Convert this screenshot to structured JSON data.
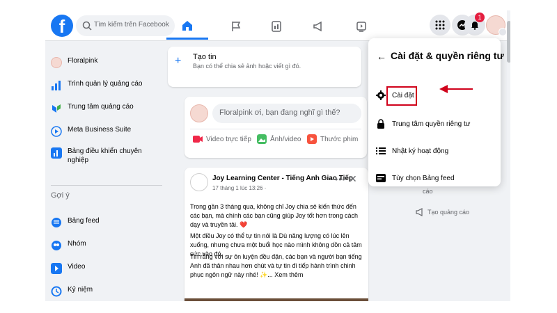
{
  "search": {
    "placeholder": "Tìm kiếm trên Facebook"
  },
  "notifications": {
    "count": "1"
  },
  "sidebar": {
    "items": [
      {
        "label": "Floralpink"
      },
      {
        "label": "Trình quản lý quảng cáo"
      },
      {
        "label": "Trung tâm quảng cáo"
      },
      {
        "label": "Meta Business Suite"
      },
      {
        "label": "Bảng điều khiển chuyên nghiệp"
      }
    ],
    "section_title": "Gợi ý",
    "suggestions": [
      {
        "label": "Bảng feed"
      },
      {
        "label": "Nhóm"
      },
      {
        "label": "Video"
      },
      {
        "label": "Kỷ niệm"
      }
    ]
  },
  "story": {
    "title": "Tạo tin",
    "subtitle": "Bạn có thể chia sẻ ảnh hoặc viết gì đó."
  },
  "composer": {
    "placeholder": "Floralpink ơi, bạn đang nghĩ gì thế?",
    "actions": [
      {
        "label": "Video trực tiếp"
      },
      {
        "label": "Ảnh/video"
      },
      {
        "label": "Thước phim"
      }
    ]
  },
  "post": {
    "author": "Joy Learning Center - Tiếng Anh Giao Tiếp",
    "time": "17 tháng 1 lúc 13:26 ·",
    "p1": "Trong gần 3 tháng qua, không chỉ Joy chia sẻ kiến thức đến các bạn, mà chính các bạn cũng giúp Joy tốt hơn trong cách dạy và truyền tải. ❤️",
    "p2": "Một điều Joy có thể tự tin nói là Dù năng lượng có lúc lên xuống, nhưng chưa một buổi học nào mình không dồn cả tâm sức vào đó.",
    "p3": "Tin rằng với sự ôn luyện đều đặn, các bạn và người bạn tiếng Anh đã thân nhau hơn chút và tự tin đi tiếp hành trình chinh phục ngôn ngữ này nhé! ✨... Xem thêm"
  },
  "right_column": {
    "text1": "cáo",
    "text2": "Tạo quảng cáo"
  },
  "dropdown": {
    "title": "Cài đặt & quyền riêng tư",
    "items": [
      {
        "label": "Cài đặt"
      },
      {
        "label": "Trung tâm quyền riêng tư"
      },
      {
        "label": "Nhật ký hoạt động"
      },
      {
        "label": "Tùy chọn Bảng feed"
      }
    ]
  },
  "colors": {
    "brand": "#1877f2",
    "annotation": "#d0021b"
  }
}
